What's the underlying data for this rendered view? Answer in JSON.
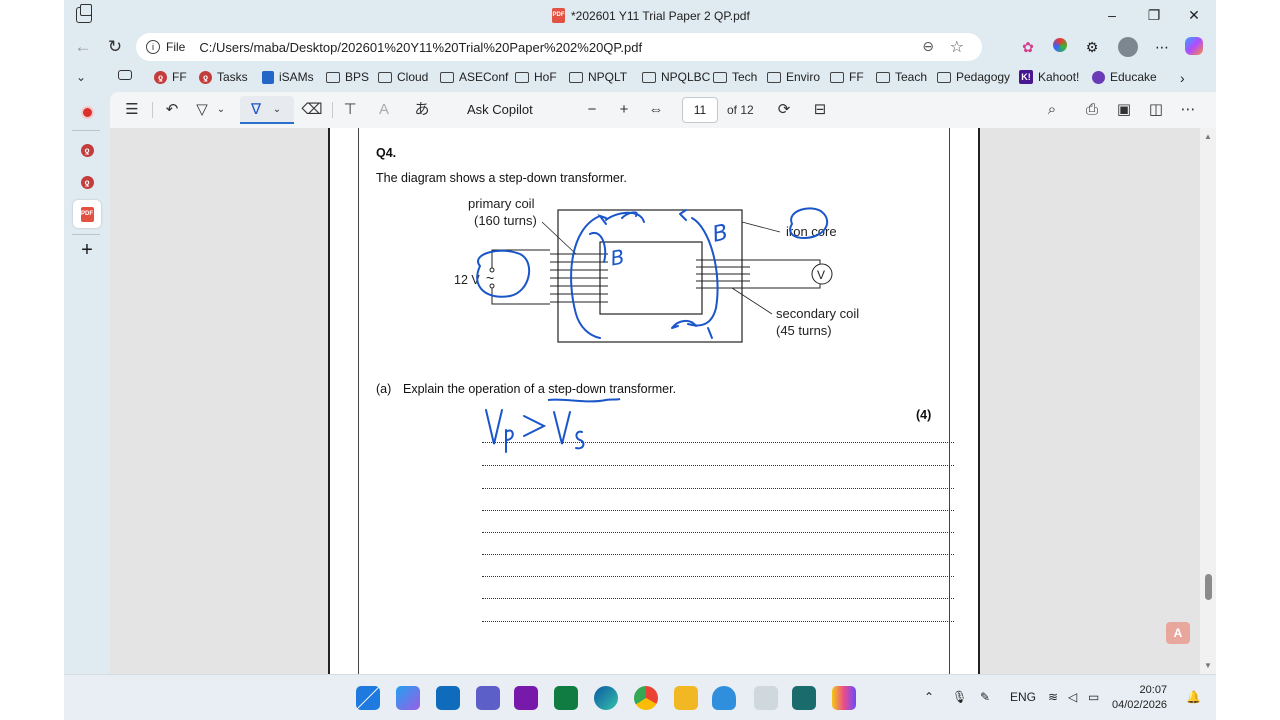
{
  "window": {
    "title": "*202601 Y11 Trial Paper 2 QP.pdf",
    "minimize": "–",
    "maximize": "❐",
    "close": "✕"
  },
  "address": {
    "file_label": "File",
    "url": "C:/Users/maba/Desktop/202601%20Y11%20Trial%20Paper%202%20QP.pdf"
  },
  "favorites": [
    {
      "label": "FF",
      "icon": "red-logo"
    },
    {
      "label": "Tasks",
      "icon": "red-logo"
    },
    {
      "label": "iSAMs",
      "icon": "blue-doc"
    },
    {
      "label": "BPS",
      "icon": "folder"
    },
    {
      "label": "Cloud",
      "icon": "folder"
    },
    {
      "label": "ASEConf",
      "icon": "folder"
    },
    {
      "label": "HoF",
      "icon": "folder"
    },
    {
      "label": "NPQLT",
      "icon": "folder"
    },
    {
      "label": "NPQLBC",
      "icon": "folder"
    },
    {
      "label": "Tech",
      "icon": "folder"
    },
    {
      "label": "Enviro",
      "icon": "folder"
    },
    {
      "label": "FF",
      "icon": "folder"
    },
    {
      "label": "Teach",
      "icon": "folder"
    },
    {
      "label": "Pedagogy",
      "icon": "folder"
    },
    {
      "label": "Kahoot!",
      "icon": "kahoot"
    },
    {
      "label": "Educake",
      "icon": "educake"
    }
  ],
  "pdf_toolbar": {
    "ask_copilot": "Ask Copilot",
    "page_current": "11",
    "page_of": "of 12",
    "read_aloud_glyph": "A",
    "translate_glyph": "あ"
  },
  "document": {
    "question": "Q4.",
    "intro": "The diagram shows a step-down transformer.",
    "labels": {
      "primary_coil": "primary coil",
      "primary_turns": "(160 turns)",
      "iron_core": "iron core",
      "secondary_coil": "secondary coil",
      "secondary_turns": "(45 turns)",
      "voltage": "12 V",
      "voltmeter": "V",
      "ac_symbol": "~"
    },
    "part_a_label": "(a)",
    "part_a_text": "Explain the operation of a step-down transformer.",
    "part_a_marks": "(4)",
    "annotation_b": "B"
  },
  "taskbar": {
    "lang": "ENG",
    "time": "20:07",
    "date": "04/02/2026"
  },
  "colors": {
    "ink": "#1a56c9",
    "accent": "#2b6fcf",
    "record": "#d9302d"
  }
}
